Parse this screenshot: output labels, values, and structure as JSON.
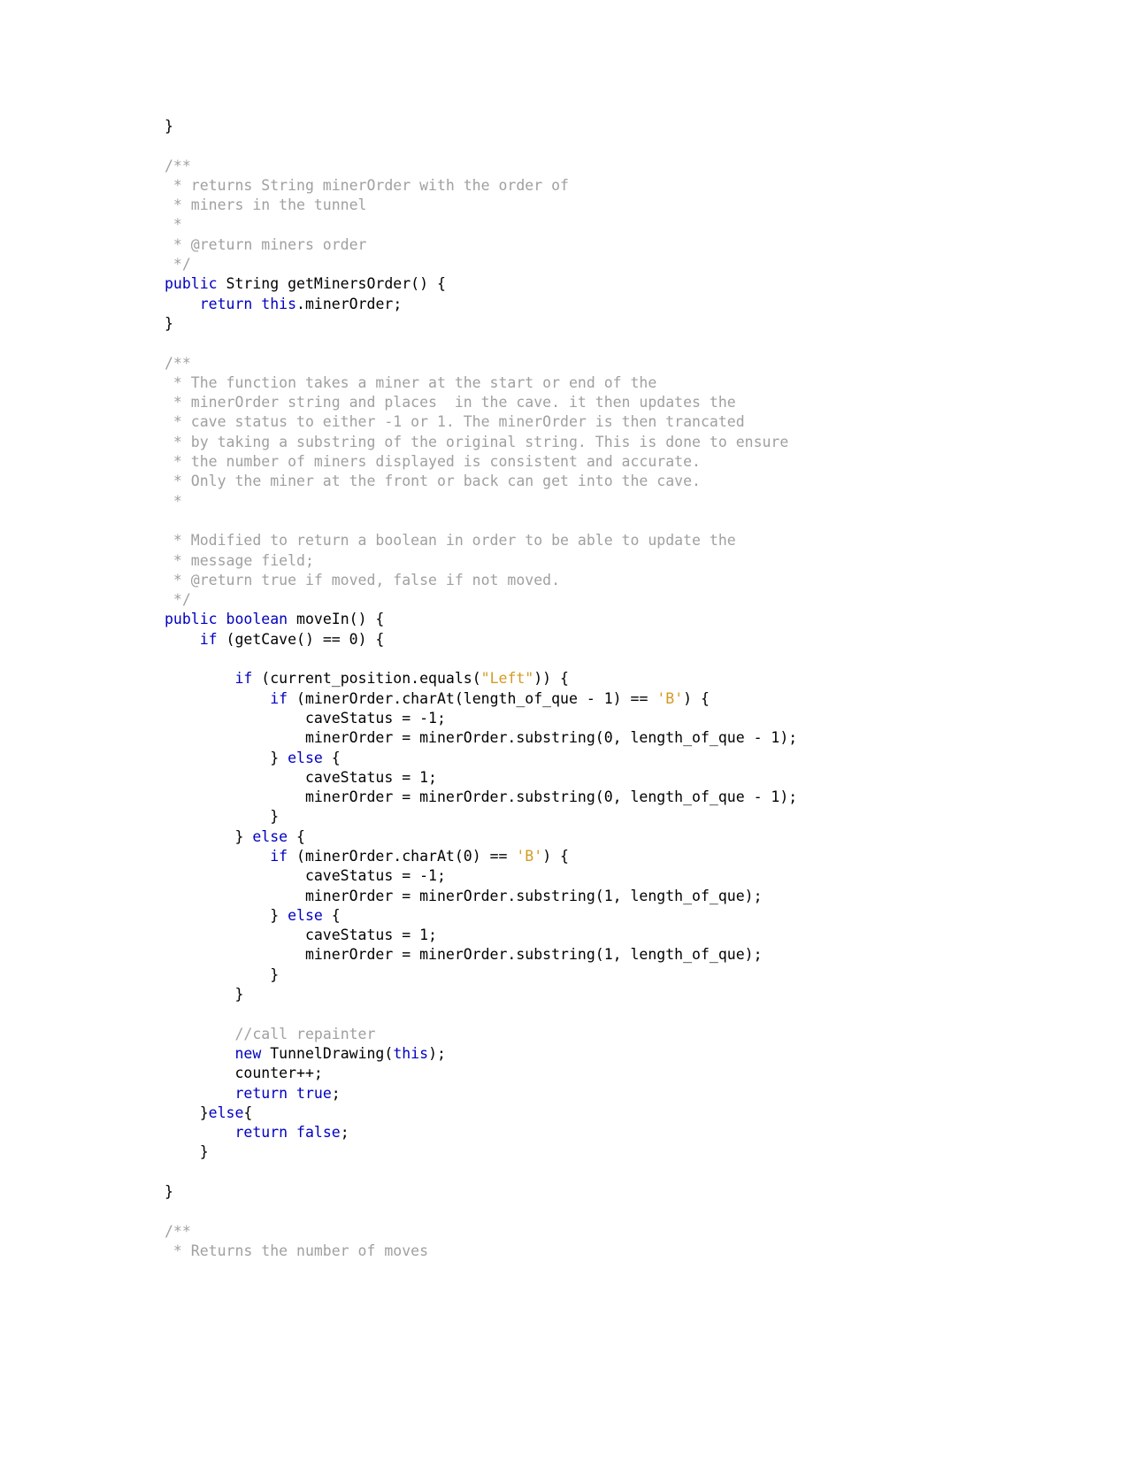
{
  "document": {
    "type": "java-source-listing",
    "language": "Java",
    "background_color": "#ffffff",
    "colors": {
      "keyword": "#0000c0",
      "comment": "#a0a0a0",
      "string": "#d49b22",
      "plain": "#000000"
    }
  },
  "code": {
    "lines": [
      {
        "tokens": [
          {
            "t": "}",
            "c": "pl"
          }
        ]
      },
      {
        "tokens": []
      },
      {
        "tokens": [
          {
            "t": "/**",
            "c": "cm"
          }
        ]
      },
      {
        "tokens": [
          {
            "t": " * returns String minerOrder with the order of",
            "c": "cm"
          }
        ]
      },
      {
        "tokens": [
          {
            "t": " * miners in the tunnel",
            "c": "cm"
          }
        ]
      },
      {
        "tokens": [
          {
            "t": " *",
            "c": "cm"
          }
        ]
      },
      {
        "tokens": [
          {
            "t": " * @return miners order",
            "c": "cm"
          }
        ]
      },
      {
        "tokens": [
          {
            "t": " */",
            "c": "cm"
          }
        ]
      },
      {
        "tokens": [
          {
            "t": "public",
            "c": "kw"
          },
          {
            "t": " String getMinersOrder() {",
            "c": "pl"
          }
        ]
      },
      {
        "tokens": [
          {
            "t": "    ",
            "c": "pl"
          },
          {
            "t": "return",
            "c": "kw"
          },
          {
            "t": " ",
            "c": "pl"
          },
          {
            "t": "this",
            "c": "kw"
          },
          {
            "t": ".minerOrder;",
            "c": "pl"
          }
        ]
      },
      {
        "tokens": [
          {
            "t": "}",
            "c": "pl"
          }
        ]
      },
      {
        "tokens": []
      },
      {
        "tokens": [
          {
            "t": "/**",
            "c": "cm"
          }
        ]
      },
      {
        "tokens": [
          {
            "t": " * The function takes a miner at the start or end of the",
            "c": "cm"
          }
        ]
      },
      {
        "tokens": [
          {
            "t": " * minerOrder string and places  in the cave. it then updates the",
            "c": "cm"
          }
        ]
      },
      {
        "tokens": [
          {
            "t": " * cave status to either -1 or 1. The minerOrder is then trancated",
            "c": "cm"
          }
        ]
      },
      {
        "tokens": [
          {
            "t": " * by taking a substring of the original string. This is done to ensure",
            "c": "cm"
          }
        ]
      },
      {
        "tokens": [
          {
            "t": " * the number of miners displayed is consistent and accurate.",
            "c": "cm"
          }
        ]
      },
      {
        "tokens": [
          {
            "t": " * Only the miner at the front or back can get into the cave.",
            "c": "cm"
          }
        ]
      },
      {
        "tokens": [
          {
            "t": " *",
            "c": "cm"
          }
        ]
      },
      {
        "tokens": []
      },
      {
        "tokens": [
          {
            "t": " * Modified to return a boolean in order to be able to update the",
            "c": "cm"
          }
        ]
      },
      {
        "tokens": [
          {
            "t": " * message field;",
            "c": "cm"
          }
        ]
      },
      {
        "tokens": [
          {
            "t": " * @return true if moved, false if not moved.",
            "c": "cm"
          }
        ]
      },
      {
        "tokens": [
          {
            "t": " */",
            "c": "cm"
          }
        ]
      },
      {
        "tokens": [
          {
            "t": "public",
            "c": "kw"
          },
          {
            "t": " ",
            "c": "pl"
          },
          {
            "t": "boolean",
            "c": "kw"
          },
          {
            "t": " moveIn() {",
            "c": "pl"
          }
        ]
      },
      {
        "tokens": [
          {
            "t": "    ",
            "c": "pl"
          },
          {
            "t": "if",
            "c": "kw"
          },
          {
            "t": " (getCave() == 0) {",
            "c": "pl"
          }
        ]
      },
      {
        "tokens": []
      },
      {
        "tokens": [
          {
            "t": "        ",
            "c": "pl"
          },
          {
            "t": "if",
            "c": "kw"
          },
          {
            "t": " (current_position.equals(",
            "c": "pl"
          },
          {
            "t": "\"Left\"",
            "c": "str"
          },
          {
            "t": ")) {",
            "c": "pl"
          }
        ]
      },
      {
        "tokens": [
          {
            "t": "            ",
            "c": "pl"
          },
          {
            "t": "if",
            "c": "kw"
          },
          {
            "t": " (minerOrder.charAt(length_of_que - 1) == ",
            "c": "pl"
          },
          {
            "t": "'B'",
            "c": "str"
          },
          {
            "t": ") {",
            "c": "pl"
          }
        ]
      },
      {
        "tokens": [
          {
            "t": "                caveStatus = -1;",
            "c": "pl"
          }
        ]
      },
      {
        "tokens": [
          {
            "t": "                minerOrder = minerOrder.substring(0, length_of_que - 1);",
            "c": "pl"
          }
        ]
      },
      {
        "tokens": [
          {
            "t": "            } ",
            "c": "pl"
          },
          {
            "t": "else",
            "c": "kw"
          },
          {
            "t": " {",
            "c": "pl"
          }
        ]
      },
      {
        "tokens": [
          {
            "t": "                caveStatus = 1;",
            "c": "pl"
          }
        ]
      },
      {
        "tokens": [
          {
            "t": "                minerOrder = minerOrder.substring(0, length_of_que - 1);",
            "c": "pl"
          }
        ]
      },
      {
        "tokens": [
          {
            "t": "            }",
            "c": "pl"
          }
        ]
      },
      {
        "tokens": [
          {
            "t": "        } ",
            "c": "pl"
          },
          {
            "t": "else",
            "c": "kw"
          },
          {
            "t": " {",
            "c": "pl"
          }
        ]
      },
      {
        "tokens": [
          {
            "t": "            ",
            "c": "pl"
          },
          {
            "t": "if",
            "c": "kw"
          },
          {
            "t": " (minerOrder.charAt(0) == ",
            "c": "pl"
          },
          {
            "t": "'B'",
            "c": "str"
          },
          {
            "t": ") {",
            "c": "pl"
          }
        ]
      },
      {
        "tokens": [
          {
            "t": "                caveStatus = -1;",
            "c": "pl"
          }
        ]
      },
      {
        "tokens": [
          {
            "t": "                minerOrder = minerOrder.substring(1, length_of_que);",
            "c": "pl"
          }
        ]
      },
      {
        "tokens": [
          {
            "t": "            } ",
            "c": "pl"
          },
          {
            "t": "else",
            "c": "kw"
          },
          {
            "t": " {",
            "c": "pl"
          }
        ]
      },
      {
        "tokens": [
          {
            "t": "                caveStatus = 1;",
            "c": "pl"
          }
        ]
      },
      {
        "tokens": [
          {
            "t": "                minerOrder = minerOrder.substring(1, length_of_que);",
            "c": "pl"
          }
        ]
      },
      {
        "tokens": [
          {
            "t": "            }",
            "c": "pl"
          }
        ]
      },
      {
        "tokens": [
          {
            "t": "        }",
            "c": "pl"
          }
        ]
      },
      {
        "tokens": []
      },
      {
        "tokens": [
          {
            "t": "        ",
            "c": "pl"
          },
          {
            "t": "//call repainter",
            "c": "cm"
          }
        ]
      },
      {
        "tokens": [
          {
            "t": "        ",
            "c": "pl"
          },
          {
            "t": "new",
            "c": "kw"
          },
          {
            "t": " TunnelDrawing(",
            "c": "pl"
          },
          {
            "t": "this",
            "c": "kw"
          },
          {
            "t": ");",
            "c": "pl"
          }
        ]
      },
      {
        "tokens": [
          {
            "t": "        counter++;",
            "c": "pl"
          }
        ]
      },
      {
        "tokens": [
          {
            "t": "        ",
            "c": "pl"
          },
          {
            "t": "return",
            "c": "kw"
          },
          {
            "t": " ",
            "c": "pl"
          },
          {
            "t": "true",
            "c": "kw"
          },
          {
            "t": ";",
            "c": "pl"
          }
        ]
      },
      {
        "tokens": [
          {
            "t": "    }",
            "c": "pl"
          },
          {
            "t": "else",
            "c": "kw"
          },
          {
            "t": "{",
            "c": "pl"
          }
        ]
      },
      {
        "tokens": [
          {
            "t": "        ",
            "c": "pl"
          },
          {
            "t": "return",
            "c": "kw"
          },
          {
            "t": " ",
            "c": "pl"
          },
          {
            "t": "false",
            "c": "kw"
          },
          {
            "t": ";",
            "c": "pl"
          }
        ]
      },
      {
        "tokens": [
          {
            "t": "    }",
            "c": "pl"
          }
        ]
      },
      {
        "tokens": []
      },
      {
        "tokens": [
          {
            "t": "}",
            "c": "pl"
          }
        ]
      },
      {
        "tokens": []
      },
      {
        "tokens": [
          {
            "t": "/**",
            "c": "cm"
          }
        ]
      },
      {
        "tokens": [
          {
            "t": " * Returns the number of moves",
            "c": "cm"
          }
        ]
      }
    ]
  }
}
